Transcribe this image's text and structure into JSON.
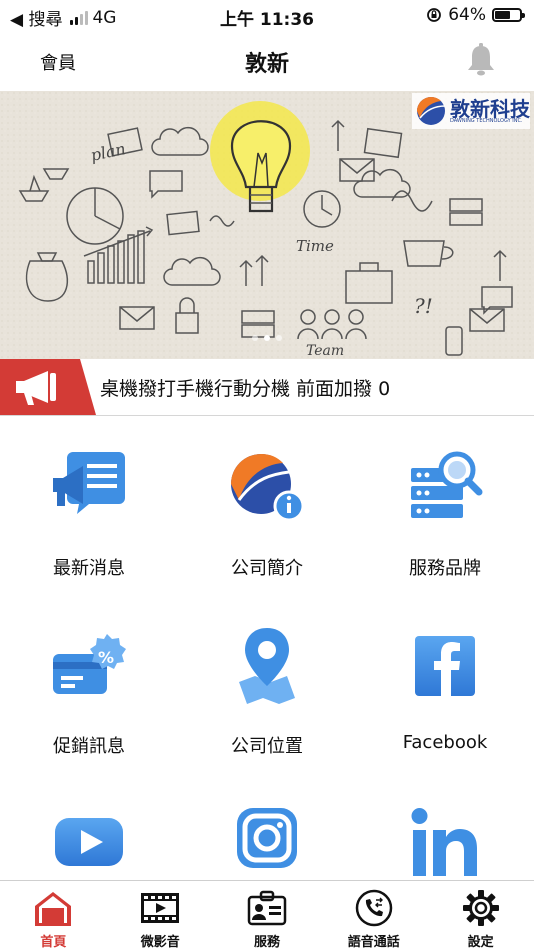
{
  "status_bar": {
    "carrier": "◀ 搜尋",
    "network": "4G",
    "time": "上午 11:36",
    "battery_percent": "64%",
    "battery_level": 0.64
  },
  "nav": {
    "left_label": "會員",
    "title": "敦新",
    "bell_icon": "bell-icon"
  },
  "banner": {
    "brand_name": "敦新科技",
    "brand_subtitle": "DAWNING TECHNOLOGY INC.",
    "sketch_words": [
      "plan",
      "Time",
      "Team",
      "?!"
    ],
    "slide_count": 3,
    "active_slide": 1
  },
  "announcement": {
    "text": "桌機撥打手機行動分機 前面加撥 0",
    "icon": "megaphone-icon",
    "accent": "#d33b36"
  },
  "menu": [
    {
      "label": "最新消息",
      "icon": "news-megaphone-icon"
    },
    {
      "label": "公司簡介",
      "icon": "company-info-icon"
    },
    {
      "label": "服務品牌",
      "icon": "server-search-icon"
    },
    {
      "label": "促銷訊息",
      "icon": "promo-card-icon"
    },
    {
      "label": "公司位置",
      "icon": "location-pin-icon"
    },
    {
      "label": "Facebook",
      "icon": "facebook-icon"
    },
    {
      "label": "",
      "icon": "youtube-icon"
    },
    {
      "label": "",
      "icon": "instagram-icon"
    },
    {
      "label": "",
      "icon": "linkedin-icon"
    }
  ],
  "tabs": [
    {
      "label": "首頁",
      "icon": "home-icon",
      "active": true
    },
    {
      "label": "微影音",
      "icon": "film-icon",
      "active": false
    },
    {
      "label": "服務",
      "icon": "id-card-icon",
      "active": false
    },
    {
      "label": "語音通話",
      "icon": "phone-call-icon",
      "active": false
    },
    {
      "label": "設定",
      "icon": "gear-icon",
      "active": false
    }
  ],
  "colors": {
    "accent_red": "#d33b36",
    "icon_blue": "#3f8fe3",
    "brand_blue": "#1f3f8f"
  }
}
